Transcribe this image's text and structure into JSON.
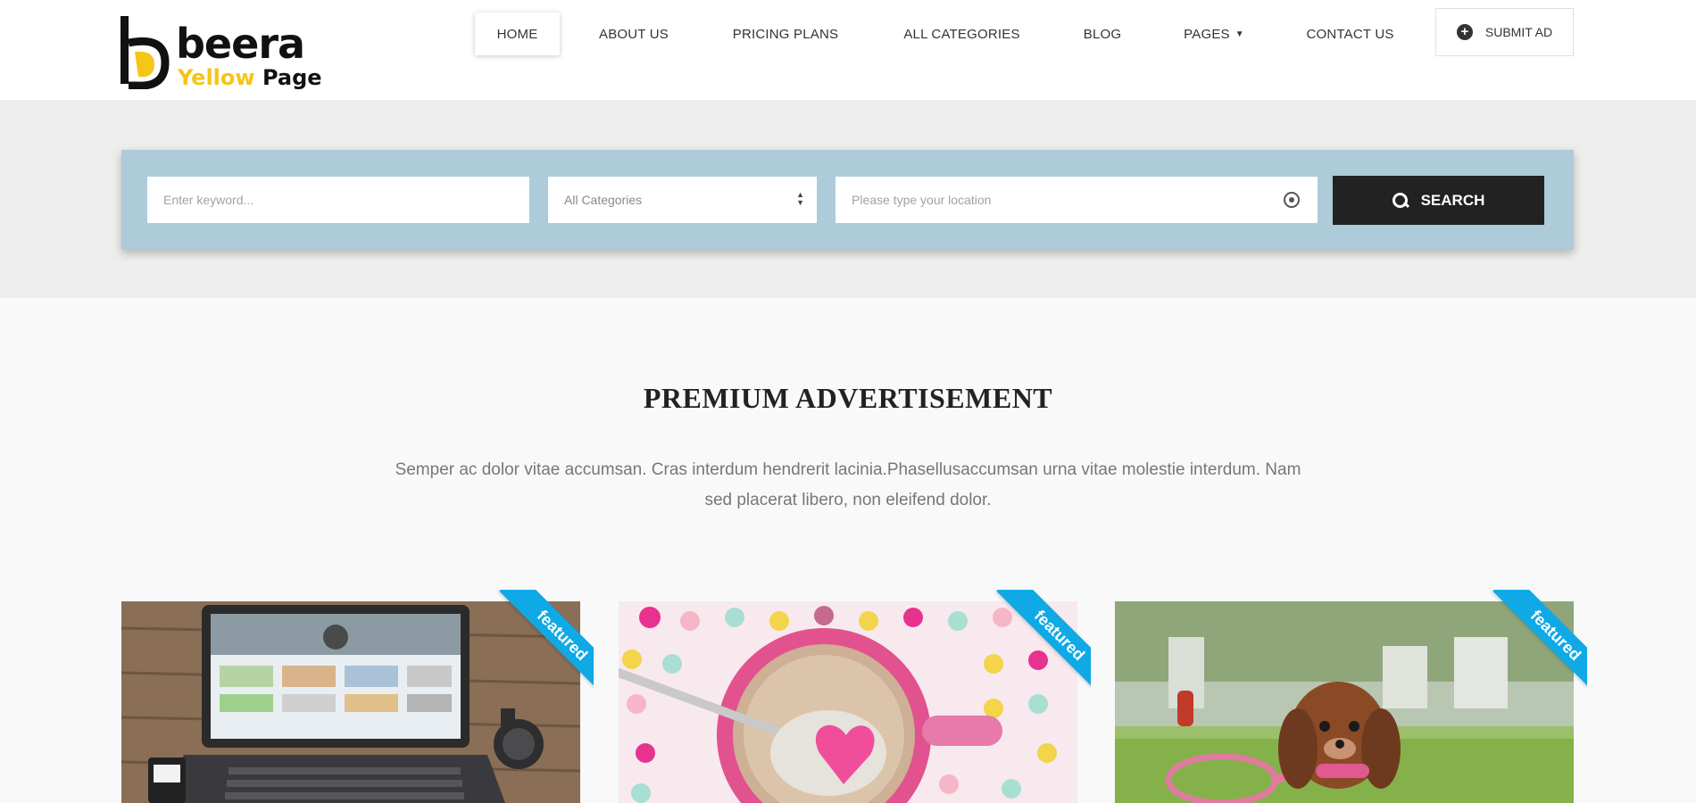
{
  "logo": {
    "brand": "beera",
    "tag_yellow": "Yellow",
    "tag_page": "Page"
  },
  "nav": {
    "items": [
      {
        "label": "HOME"
      },
      {
        "label": "ABOUT US"
      },
      {
        "label": "PRICING PLANS"
      },
      {
        "label": "ALL CATEGORIES"
      },
      {
        "label": "BLOG"
      },
      {
        "label": "PAGES"
      },
      {
        "label": "CONTACT US"
      }
    ],
    "submit_label": "SUBMIT AD"
  },
  "search": {
    "keyword_placeholder": "Enter keyword...",
    "category_selected": "All Categories",
    "location_placeholder": "Please type your location",
    "button_label": "SEARCH"
  },
  "section": {
    "title": "PREMIUM ADVERTISEMENT",
    "description": "Semper ac dolor vitae accumsan. Cras interdum hendrerit lacinia.Phasellusaccumsan urna vitae molestie interdum. Nam sed placerat libero, non eleifend dolor."
  },
  "cards": [
    {
      "badge": "featured"
    },
    {
      "badge": "featured"
    },
    {
      "badge": "featured"
    }
  ],
  "colors": {
    "brand_yellow": "#f5c518",
    "search_panel": "#adcbd8",
    "search_button": "#222222",
    "featured_ribbon": "#0fa9e6"
  }
}
